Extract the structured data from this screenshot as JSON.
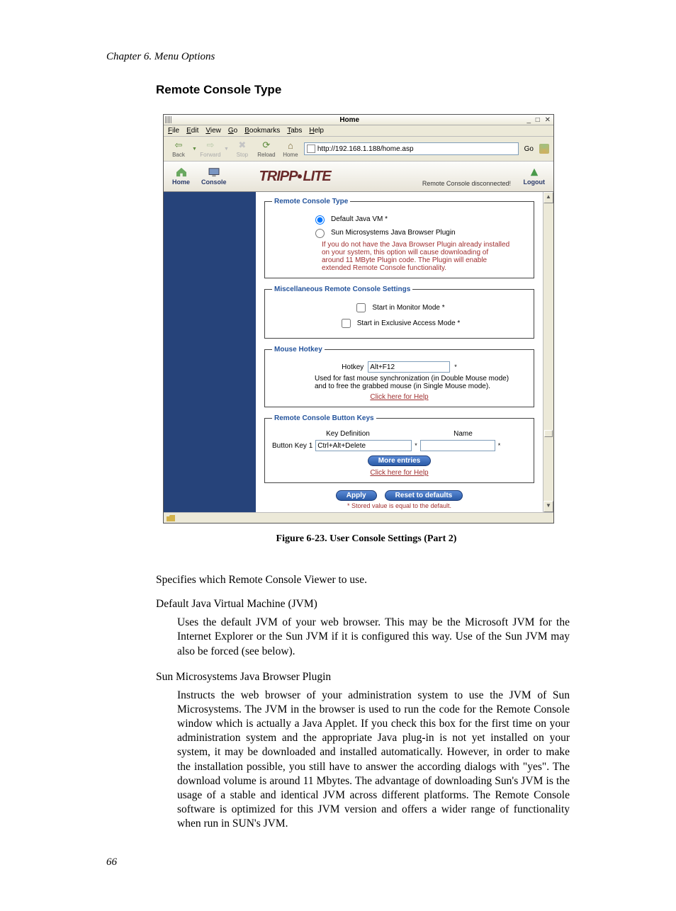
{
  "page": {
    "running_head": "Chapter 6. Menu Options",
    "section_title": "Remote Console Type",
    "page_number": "66"
  },
  "browser": {
    "title": "Home",
    "menus": {
      "file": "File",
      "edit": "Edit",
      "view": "View",
      "go": "Go",
      "bookmarks": "Bookmarks",
      "tabs": "Tabs",
      "help": "Help"
    },
    "toolbar": {
      "back": "Back",
      "forward": "Forward",
      "stop": "Stop",
      "reload": "Reload",
      "home": "Home",
      "go": "Go"
    },
    "url": "http://192.168.1.188/home.asp"
  },
  "app": {
    "header": {
      "home": "Home",
      "console": "Console",
      "logout": "Logout",
      "logo": "TRIPP·LITE",
      "disconnected": "Remote Console disconnected!"
    },
    "fs1": {
      "legend": "Remote Console Type",
      "opt1": "Default Java VM *",
      "opt2": "Sun Microsystems Java Browser Plugin",
      "warn": "If you do not have the Java Browser Plugin already installed on your system, this option will cause downloading of around 11 MByte Plugin code. The Plugin will enable extended Remote Console functionality."
    },
    "fs2": {
      "legend": "Miscellaneous Remote Console Settings",
      "opt1": "Start in Monitor Mode *",
      "opt2": "Start in Exclusive Access Mode *"
    },
    "fs3": {
      "legend": "Mouse Hotkey",
      "label_hotkey": "Hotkey",
      "hotkey_value": "Alt+F12",
      "desc": "Used for fast mouse synchronization (in Double Mouse mode) and to free the grabbed mouse (in Single Mouse mode).",
      "help": "Click here for Help"
    },
    "fs4": {
      "legend": "Remote Console Button Keys",
      "col_keydef": "Key Definition",
      "col_name": "Name",
      "row_label": "Button Key 1",
      "row_value": "Ctrl+Alt+Delete",
      "more": "More entries",
      "help": "Click here for Help"
    },
    "buttons": {
      "apply": "Apply",
      "reset": "Reset to defaults"
    },
    "footer_note": "* Stored value is equal to the default."
  },
  "caption": "Figure 6-23. User Console Settings (Part 2)",
  "body": {
    "intro": "Specifies which Remote Console Viewer to use.",
    "dt1": "Default Java Virtual Machine (JVM)",
    "dd1": "Uses the default JVM of your web browser. This may be the Microsoft JVM for the Internet Explorer or the Sun JVM if it is configured this way. Use of the Sun JVM may also be forced (see below).",
    "dt2": "Sun Microsystems Java Browser Plugin",
    "dd2": "Instructs the web browser of your administration system to use the JVM of Sun Microsystems. The JVM in the browser is used to run the code for the Remote Console window which is actually a Java Applet. If you check this box for the first time on your administration system and the appropriate Java plug-in is not yet installed on your system, it may be downloaded and installed automatically. However, in order to make the installation possible, you still have to answer the according dialogs with \"yes\". The download volume is around 11 Mbytes. The advantage of downloading Sun's JVM is the usage of a stable and identical JVM across different platforms. The Remote Console software is optimized for this JVM version and offers a wider range of functionality when run in SUN's JVM."
  }
}
